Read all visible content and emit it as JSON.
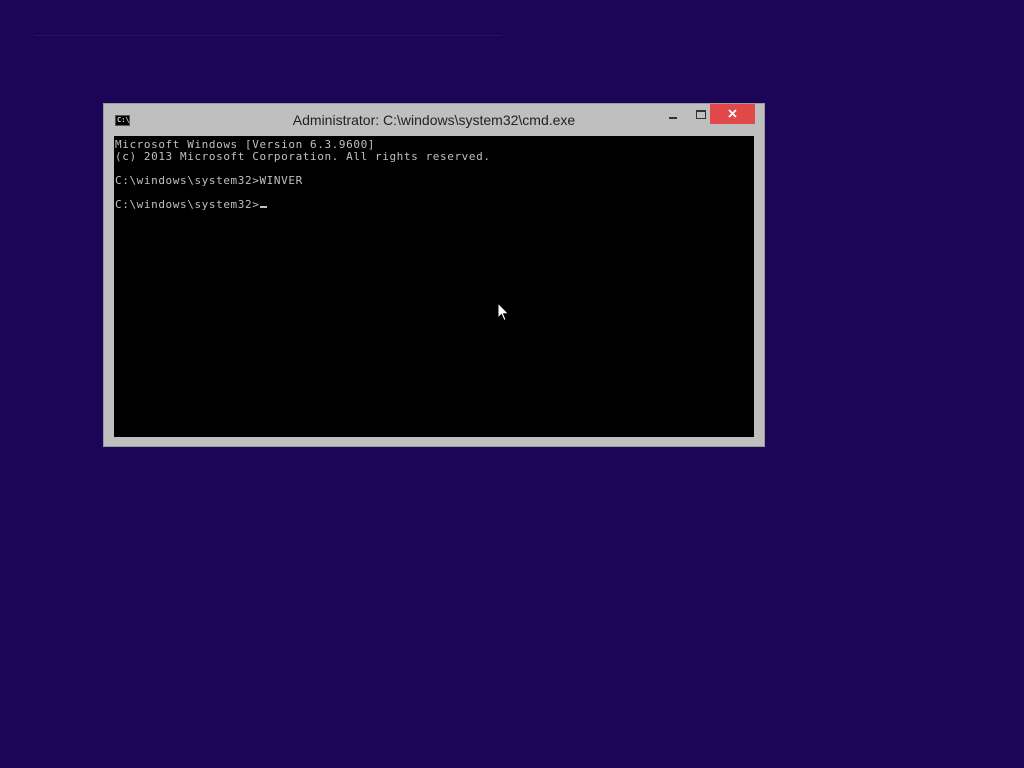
{
  "window": {
    "title": "Administrator: C:\\windows\\system32\\cmd.exe",
    "icon_label": "C:\\",
    "icon": "cmd-icon"
  },
  "titlebar_buttons": {
    "minimize_icon": "minimize-icon",
    "maximize_icon": "maximize-icon",
    "close_icon": "close-icon",
    "close_color": "#e0484a"
  },
  "console": {
    "lines": [
      "Microsoft Windows [Version 6.3.9600]",
      "(c) 2013 Microsoft Corporation. All rights reserved.",
      "",
      "C:\\windows\\system32>WINVER",
      "",
      "C:\\windows\\system32>"
    ],
    "background": "#000000",
    "text_color": "#c0c0c0"
  },
  "desktop": {
    "background": "#1c0456"
  }
}
